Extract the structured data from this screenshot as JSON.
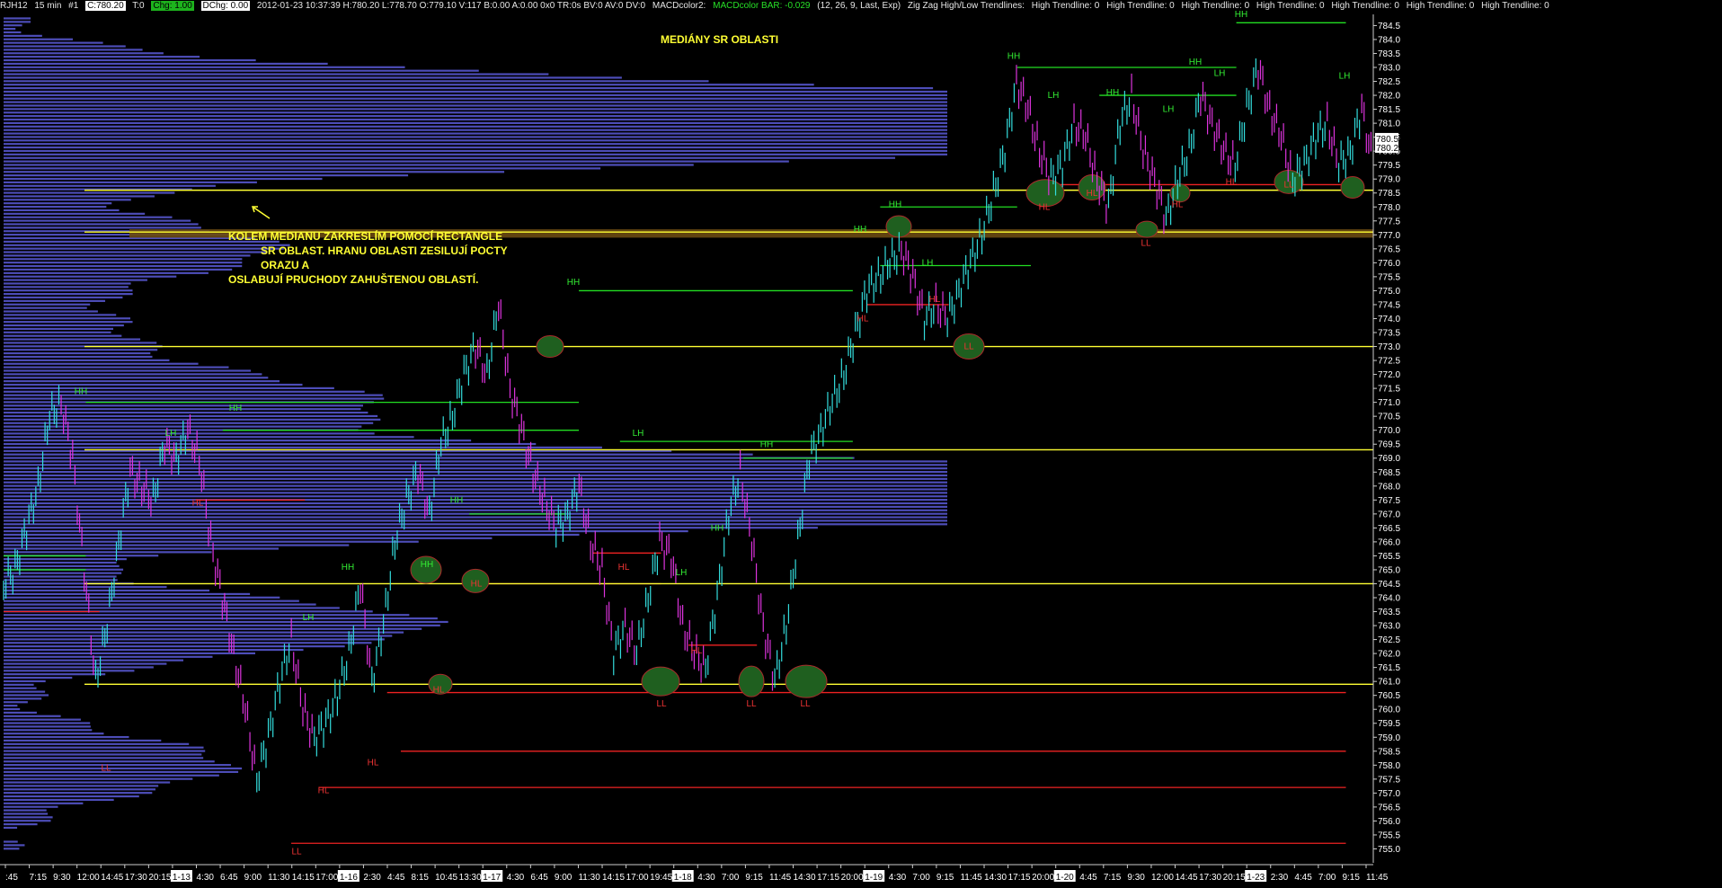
{
  "header": {
    "symbol": "RJH12",
    "timeframe": "15 min",
    "chart_no": "#1",
    "close": "C:780.20",
    "t": "T:0",
    "chg": "Chg: 1.00",
    "dchg": "DChg: 0.00",
    "bar_info": "2012-01-23 10:37:39 H:780.20 L:778.70 O:779.10 V:117 B:0.00 A:0.00 0x0 TR:0s BV:0 AV:0 DV:0",
    "macd_name": "MACDcolor2:",
    "macd_bar": "MACDcolor BAR: -0.029",
    "macd_params": "(12, 26, 9, Last, Exp)",
    "zigzag": "Zig Zag High/Low Trendlines:",
    "trendlines": [
      "High Trendline: 0",
      "High Trendline: 0",
      "High Trendline: 0",
      "High Trendline: 0",
      "High Trendline: 0",
      "High Trendline: 0",
      "High Trendline: 0"
    ]
  },
  "annotations": {
    "title": "MEDIÁNY SR OBLASTI",
    "note_lines": [
      "KOLEM MEDIANU ZAKRESLÍM POMOCÍ RECTANGLE",
      "SR OBLAST. HRANU OBLASTI ZESILUJÍ POCTY ORAZU A",
      "OSLABUJÍ PRUCHODY ZAHUŠTENOU OBLASTÍ."
    ]
  },
  "colors": {
    "background": "#000000",
    "volume_profile": "#5a5ad8",
    "price_up": "#33dddd",
    "price_down": "#dd33dd",
    "median_line": "#ffff33",
    "support_line": "#ee2222",
    "resistance_line": "#22dd22",
    "swing_circle": "#1f5f1f",
    "axis_label": "#ffffff"
  },
  "chart_data": {
    "type": "line",
    "title": "",
    "xlabel": "",
    "ylabel": "",
    "ylim": [
      754.5,
      784.9
    ],
    "yticks": [
      755.0,
      755.5,
      756.0,
      756.5,
      757.0,
      757.5,
      758.0,
      758.5,
      759.0,
      759.5,
      760.0,
      760.5,
      761.0,
      761.5,
      762.0,
      762.5,
      763.0,
      763.5,
      764.0,
      764.5,
      765.0,
      765.5,
      766.0,
      766.5,
      767.0,
      767.5,
      768.0,
      768.5,
      769.0,
      769.5,
      770.0,
      770.5,
      771.0,
      771.5,
      772.0,
      772.5,
      773.0,
      773.5,
      774.0,
      774.5,
      775.0,
      775.5,
      776.0,
      776.5,
      777.0,
      777.5,
      778.0,
      778.5,
      779.0,
      779.5,
      780.0,
      780.5,
      781.0,
      781.5,
      782.0,
      782.5,
      783.0,
      783.5,
      784.0,
      784.5
    ],
    "last_price": "780.20",
    "last_price_axis": "780.50",
    "xticks": [
      {
        "label": ":45",
        "box": false
      },
      {
        "label": "7:15",
        "box": false
      },
      {
        "label": "9:30",
        "box": false
      },
      {
        "label": "12:00",
        "box": false
      },
      {
        "label": "14:45",
        "box": false
      },
      {
        "label": "17:30",
        "box": false
      },
      {
        "label": "20:15",
        "box": false
      },
      {
        "label": "1-13",
        "box": true
      },
      {
        "label": "4:30",
        "box": false
      },
      {
        "label": "6:45",
        "box": false
      },
      {
        "label": "9:00",
        "box": false
      },
      {
        "label": "11:30",
        "box": false
      },
      {
        "label": "14:15",
        "box": false
      },
      {
        "label": "17:00",
        "box": false
      },
      {
        "label": "1-16",
        "box": true
      },
      {
        "label": "2:30",
        "box": false
      },
      {
        "label": "4:45",
        "box": false
      },
      {
        "label": "8:15",
        "box": false
      },
      {
        "label": "10:45",
        "box": false
      },
      {
        "label": "13:30",
        "box": false
      },
      {
        "label": "1-17",
        "box": true
      },
      {
        "label": "4:30",
        "box": false
      },
      {
        "label": "6:45",
        "box": false
      },
      {
        "label": "9:00",
        "box": false
      },
      {
        "label": "11:30",
        "box": false
      },
      {
        "label": "14:15",
        "box": false
      },
      {
        "label": "17:00",
        "box": false
      },
      {
        "label": "19:45",
        "box": false
      },
      {
        "label": "1-18",
        "box": true
      },
      {
        "label": "4:30",
        "box": false
      },
      {
        "label": "7:00",
        "box": false
      },
      {
        "label": "9:15",
        "box": false
      },
      {
        "label": "11:45",
        "box": false
      },
      {
        "label": "14:30",
        "box": false
      },
      {
        "label": "17:15",
        "box": false
      },
      {
        "label": "20:00",
        "box": false
      },
      {
        "label": "1-19",
        "box": true
      },
      {
        "label": "4:30",
        "box": false
      },
      {
        "label": "7:00",
        "box": false
      },
      {
        "label": "9:15",
        "box": false
      },
      {
        "label": "11:45",
        "box": false
      },
      {
        "label": "14:30",
        "box": false
      },
      {
        "label": "17:15",
        "box": false
      },
      {
        "label": "20:00",
        "box": false
      },
      {
        "label": "1-20",
        "box": true
      },
      {
        "label": "4:45",
        "box": false
      },
      {
        "label": "7:15",
        "box": false
      },
      {
        "label": "9:30",
        "box": false
      },
      {
        "label": "12:00",
        "box": false
      },
      {
        "label": "14:45",
        "box": false
      },
      {
        "label": "17:30",
        "box": false
      },
      {
        "label": "20:15",
        "box": false
      },
      {
        "label": "1-23",
        "box": true
      },
      {
        "label": "2:30",
        "box": false
      },
      {
        "label": "4:45",
        "box": false
      },
      {
        "label": "7:00",
        "box": false
      },
      {
        "label": "9:15",
        "box": false
      },
      {
        "label": "11:45",
        "box": false
      }
    ],
    "series": [
      {
        "values": [
          764.5,
          765,
          766.5,
          768,
          770.5,
          771,
          769,
          765,
          761,
          763,
          766,
          768.5,
          768,
          767.5,
          769.5,
          769,
          770,
          769,
          766,
          764,
          762,
          760,
          757.5,
          759,
          761,
          762.5,
          760,
          759,
          759.5,
          760.5,
          762,
          764.5,
          761,
          763,
          766,
          767.5,
          768.5,
          767,
          769.5,
          770.5,
          772,
          773,
          772,
          774.5,
          771.5,
          770,
          768.5,
          767.5,
          766.5,
          767,
          768,
          766,
          765,
          762,
          763,
          762,
          764,
          766,
          765.5,
          763,
          762,
          761.5,
          764,
          767,
          768.5,
          766,
          763,
          761,
          763,
          766,
          769,
          770,
          771,
          772,
          773.5,
          775,
          775.5,
          776,
          776.5,
          775.5,
          774,
          774.5,
          774,
          775,
          776,
          777,
          778.5,
          780,
          782.5,
          781.5,
          780,
          779,
          779.5,
          781,
          780.5,
          779,
          778,
          781,
          782,
          780,
          779,
          777.5,
          779,
          780,
          782,
          781,
          780,
          779.5,
          781.5,
          783,
          781.5,
          780.5,
          779,
          779.5,
          780.5,
          781,
          779.5,
          780,
          781.5,
          779.5
        ]
      }
    ],
    "median_levels": [
      778.6,
      777.1,
      773.0,
      769.3,
      764.5,
      760.9
    ],
    "median_zone": [
      776.9,
      777.2
    ],
    "resistance_levels": [
      {
        "y": 771.0,
        "x_frac": [
          0.06,
          0.42
        ]
      },
      {
        "y": 770.0,
        "x_frac": [
          0.16,
          0.42
        ]
      },
      {
        "y": 769.6,
        "x_frac": [
          0.45,
          0.62
        ]
      },
      {
        "y": 769.0,
        "x_frac": [
          0.54,
          0.62
        ]
      },
      {
        "y": 775.0,
        "x_frac": [
          0.42,
          0.62
        ]
      },
      {
        "y": 778.0,
        "x_frac": [
          0.64,
          0.74
        ]
      },
      {
        "y": 775.9,
        "x_frac": [
          0.64,
          0.75
        ]
      },
      {
        "y": 783.0,
        "x_frac": [
          0.74,
          0.9
        ]
      },
      {
        "y": 782.0,
        "x_frac": [
          0.8,
          0.9
        ]
      },
      {
        "y": 784.6,
        "x_frac": [
          0.9,
          0.98
        ]
      },
      {
        "y": 767.0,
        "x_frac": [
          0.34,
          0.41
        ]
      },
      {
        "y": 765.5,
        "x_frac": [
          0.0,
          0.06
        ]
      },
      {
        "y": 765.0,
        "x_frac": [
          0.0,
          0.06
        ]
      }
    ],
    "support_levels": [
      {
        "y": 755.2,
        "x_frac": [
          0.21,
          0.98
        ]
      },
      {
        "y": 757.2,
        "x_frac": [
          0.23,
          0.98
        ]
      },
      {
        "y": 758.5,
        "x_frac": [
          0.29,
          0.98
        ]
      },
      {
        "y": 760.6,
        "x_frac": [
          0.28,
          0.98
        ]
      },
      {
        "y": 764.5,
        "x_frac": [
          0.34,
          0.48
        ]
      },
      {
        "y": 765.6,
        "x_frac": [
          0.43,
          0.48
        ]
      },
      {
        "y": 762.3,
        "x_frac": [
          0.5,
          0.55
        ]
      },
      {
        "y": 767.5,
        "x_frac": [
          0.14,
          0.22
        ]
      },
      {
        "y": 774.5,
        "x_frac": [
          0.63,
          0.69
        ]
      },
      {
        "y": 778.8,
        "x_frac": [
          0.75,
          0.98
        ]
      },
      {
        "y": 763.5,
        "x_frac": [
          0.0,
          0.07
        ]
      }
    ],
    "swing_labels": [
      {
        "text": "HH",
        "x": 90,
        "y": 771.3,
        "c": "g"
      },
      {
        "text": "LH",
        "x": 190,
        "y": 769.8,
        "c": "g"
      },
      {
        "text": "HH",
        "x": 262,
        "y": 770.7,
        "c": "g"
      },
      {
        "text": "HL",
        "x": 220,
        "y": 767.3,
        "c": "r"
      },
      {
        "text": "LL",
        "x": 118,
        "y": 757.8,
        "c": "r"
      },
      {
        "text": "LL",
        "x": 330,
        "y": 754.8,
        "c": "r"
      },
      {
        "text": "HL",
        "x": 360,
        "y": 757.0,
        "c": "r"
      },
      {
        "text": "HL",
        "x": 415,
        "y": 758.0,
        "c": "r"
      },
      {
        "text": "HH",
        "x": 387,
        "y": 765.0,
        "c": "g"
      },
      {
        "text": "LH",
        "x": 343,
        "y": 763.2,
        "c": "g"
      },
      {
        "text": "HH",
        "x": 475,
        "y": 765.1,
        "c": "g"
      },
      {
        "text": "HL",
        "x": 488,
        "y": 760.6,
        "c": "r"
      },
      {
        "text": "HL",
        "x": 530,
        "y": 764.4,
        "c": "r"
      },
      {
        "text": "HH",
        "x": 508,
        "y": 767.4,
        "c": "g"
      },
      {
        "text": "HH",
        "x": 638,
        "y": 775.2,
        "c": "g"
      },
      {
        "text": "LH",
        "x": 710,
        "y": 769.8,
        "c": "g"
      },
      {
        "text": "HL",
        "x": 694,
        "y": 765.0,
        "c": "r"
      },
      {
        "text": "LL",
        "x": 736,
        "y": 760.1,
        "c": "r"
      },
      {
        "text": "LH",
        "x": 758,
        "y": 764.8,
        "c": "g"
      },
      {
        "text": "HH",
        "x": 798,
        "y": 766.4,
        "c": "g"
      },
      {
        "text": "HL",
        "x": 775,
        "y": 762.0,
        "c": "r"
      },
      {
        "text": "LL",
        "x": 836,
        "y": 760.1,
        "c": "r"
      },
      {
        "text": "LL",
        "x": 896,
        "y": 760.1,
        "c": "r"
      },
      {
        "text": "HH",
        "x": 853,
        "y": 769.4,
        "c": "g"
      },
      {
        "text": "HH",
        "x": 957,
        "y": 777.1,
        "c": "g"
      },
      {
        "text": "HL",
        "x": 960,
        "y": 773.9,
        "c": "r"
      },
      {
        "text": "HH",
        "x": 996,
        "y": 778.0,
        "c": "g"
      },
      {
        "text": "HL",
        "x": 1040,
        "y": 774.6,
        "c": "r"
      },
      {
        "text": "LH",
        "x": 1032,
        "y": 775.9,
        "c": "g"
      },
      {
        "text": "LL",
        "x": 1078,
        "y": 772.9,
        "c": "r"
      },
      {
        "text": "HH",
        "x": 1128,
        "y": 783.3,
        "c": "g"
      },
      {
        "text": "LH",
        "x": 1172,
        "y": 781.9,
        "c": "g"
      },
      {
        "text": "HL",
        "x": 1162,
        "y": 777.9,
        "c": "r"
      },
      {
        "text": "HL",
        "x": 1215,
        "y": 778.4,
        "c": "r"
      },
      {
        "text": "HH",
        "x": 1238,
        "y": 782.0,
        "c": "g"
      },
      {
        "text": "LL",
        "x": 1275,
        "y": 776.6,
        "c": "r"
      },
      {
        "text": "LH",
        "x": 1300,
        "y": 781.4,
        "c": "g"
      },
      {
        "text": "HL",
        "x": 1310,
        "y": 778.0,
        "c": "r"
      },
      {
        "text": "HH",
        "x": 1330,
        "y": 783.1,
        "c": "g"
      },
      {
        "text": "LH",
        "x": 1357,
        "y": 782.7,
        "c": "g"
      },
      {
        "text": "HL",
        "x": 1370,
        "y": 778.8,
        "c": "r"
      },
      {
        "text": "HH",
        "x": 1381,
        "y": 784.8,
        "c": "g"
      },
      {
        "text": "LH",
        "x": 1496,
        "y": 782.6,
        "c": "g"
      },
      {
        "text": "LL",
        "x": 1434,
        "y": 778.7,
        "c": "r"
      }
    ],
    "circles": [
      {
        "x": 612,
        "y": 773.0,
        "rx": 15,
        "ry": 12
      },
      {
        "x": 474,
        "y": 765.0,
        "rx": 17,
        "ry": 15
      },
      {
        "x": 529,
        "y": 764.6,
        "rx": 15,
        "ry": 13
      },
      {
        "x": 490,
        "y": 760.9,
        "rx": 13,
        "ry": 11
      },
      {
        "x": 735,
        "y": 761.0,
        "rx": 21,
        "ry": 16
      },
      {
        "x": 836,
        "y": 761.0,
        "rx": 14,
        "ry": 17
      },
      {
        "x": 897,
        "y": 761.0,
        "rx": 23,
        "ry": 18
      },
      {
        "x": 1000,
        "y": 777.3,
        "rx": 14,
        "ry": 12
      },
      {
        "x": 1078,
        "y": 773.0,
        "rx": 17,
        "ry": 14
      },
      {
        "x": 1163,
        "y": 778.5,
        "rx": 21,
        "ry": 15
      },
      {
        "x": 1215,
        "y": 778.7,
        "rx": 15,
        "ry": 14
      },
      {
        "x": 1276,
        "y": 777.2,
        "rx": 12,
        "ry": 9
      },
      {
        "x": 1313,
        "y": 778.5,
        "rx": 11,
        "ry": 10
      },
      {
        "x": 1434,
        "y": 778.9,
        "rx": 16,
        "ry": 13
      },
      {
        "x": 1505,
        "y": 778.7,
        "rx": 13,
        "ry": 12
      }
    ]
  }
}
